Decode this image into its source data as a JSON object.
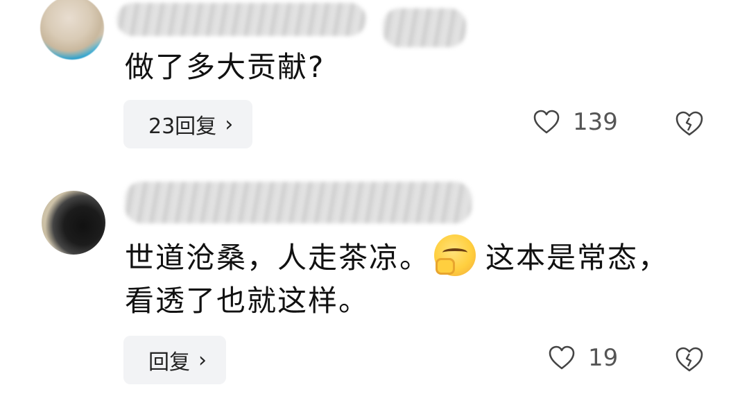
{
  "comments": [
    {
      "text": "做了多大贡献?",
      "reply_label": "23回复",
      "like_count": "139"
    },
    {
      "text_line1_a": "世道沧桑，人走茶凉。",
      "text_line1_b": "这本是常态，",
      "text_line2": "看透了也就这样。",
      "emoji": "thinking-smirk-emoji",
      "reply_label": "回复",
      "like_count": "19"
    }
  ],
  "icons": {
    "reply_chevron": "›",
    "like": "heart-outline-icon",
    "dislike": "broken-heart-icon"
  },
  "colors": {
    "reply_bg": "#f2f3f5",
    "text": "#111111",
    "secondary": "#555555"
  }
}
